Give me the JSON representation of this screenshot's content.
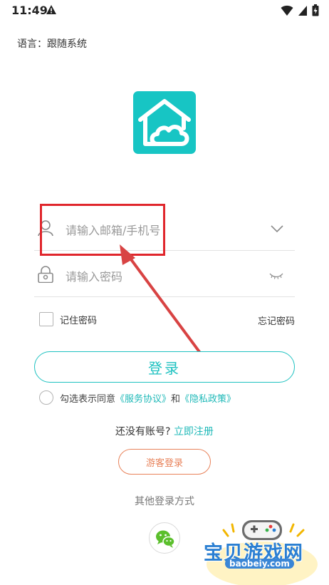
{
  "status_bar": {
    "time": "11:49",
    "icons": [
      "warning-icon",
      "wifi-icon",
      "signal-icon",
      "battery-icon"
    ]
  },
  "language": {
    "label": "语言：跟随系统"
  },
  "form": {
    "account_placeholder": "请输入邮箱/手机号",
    "password_placeholder": "请输入密码",
    "remember_label": "记住密码",
    "forgot_label": "忘记密码",
    "login_label": "登录",
    "agree": {
      "prefix": "勾选表示同意",
      "service": "《服务协议》",
      "and": "和",
      "privacy": "《隐私政策》"
    },
    "register": {
      "question": "还没有账号?",
      "link": "立即注册"
    },
    "guest_label": "游客登录",
    "other_methods_label": "其他登录方式"
  },
  "watermark": {
    "title": "宝贝游戏网",
    "url": "baobeiy.com"
  },
  "colors": {
    "accent": "#1fc2c1",
    "logo_bg": "#17c5c4",
    "guest": "#e8825a",
    "annotation": "#e0262c",
    "wechat": "#5bbf2c"
  }
}
